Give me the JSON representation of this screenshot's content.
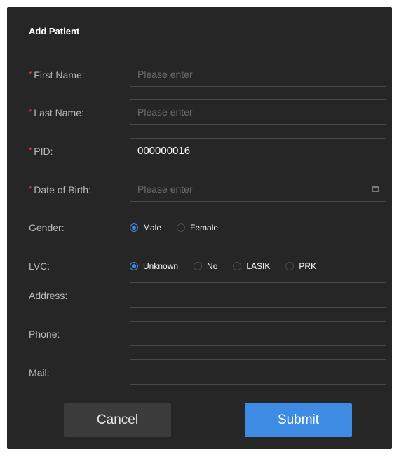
{
  "dialog": {
    "title": "Add Patient"
  },
  "colors": {
    "background": "#262626",
    "accent": "#3d8be3",
    "required": "#e04848"
  },
  "fields": {
    "first_name": {
      "label": "First Name:",
      "required": true,
      "value": "",
      "placeholder": "Please enter"
    },
    "last_name": {
      "label": "Last Name:",
      "required": true,
      "value": "",
      "placeholder": "Please enter"
    },
    "pid": {
      "label": "PID:",
      "required": true,
      "value": "000000016",
      "placeholder": ""
    },
    "dob": {
      "label": "Date of Birth:",
      "required": true,
      "value": "",
      "placeholder": "Please enter",
      "icon": "calendar-icon"
    },
    "address": {
      "label": "Address:",
      "value": "",
      "placeholder": ""
    },
    "phone": {
      "label": "Phone:",
      "value": "",
      "placeholder": ""
    },
    "mail": {
      "label": "Mail:",
      "value": "",
      "placeholder": ""
    }
  },
  "gender": {
    "label": "Gender:",
    "selected": "Male",
    "options": [
      "Male",
      "Female"
    ]
  },
  "lvc": {
    "label": "LVC:",
    "selected": "Unknown",
    "options": [
      "Unknown",
      "No",
      "LASIK",
      "PRK"
    ]
  },
  "actions": {
    "cancel": "Cancel",
    "submit": "Submit"
  }
}
